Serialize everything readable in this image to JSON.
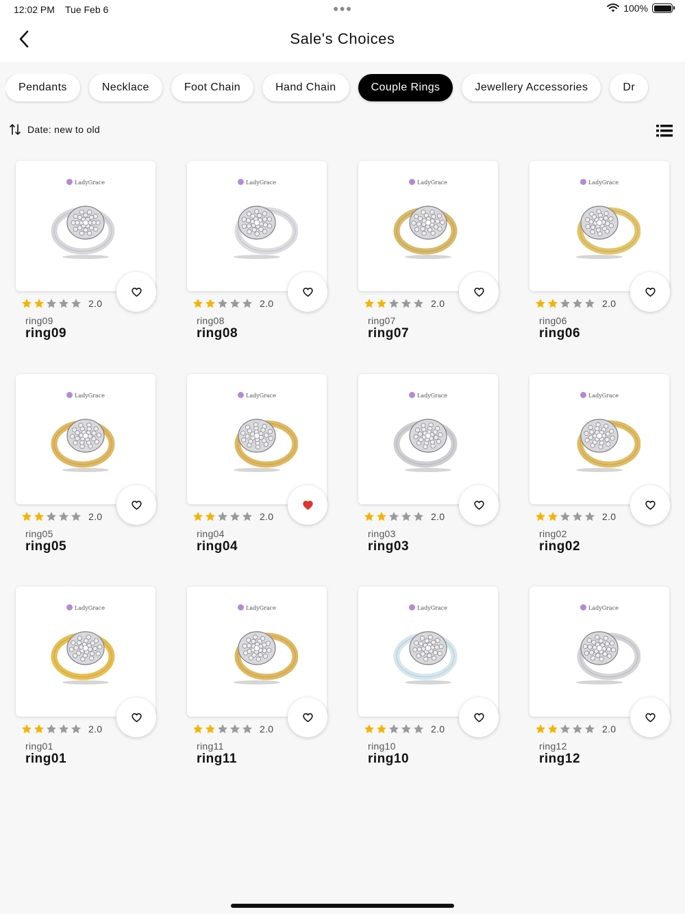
{
  "status": {
    "time": "12:02 PM",
    "date": "Tue Feb 6",
    "battery": "100%"
  },
  "nav": {
    "title": "Sale's Choices"
  },
  "categories": [
    {
      "label": "Pendants",
      "active": false
    },
    {
      "label": "Necklace",
      "active": false
    },
    {
      "label": "Foot Chain",
      "active": false
    },
    {
      "label": "Hand Chain",
      "active": false
    },
    {
      "label": "Couple Rings",
      "active": true
    },
    {
      "label": "Jewellery Accessories",
      "active": false
    },
    {
      "label": "Dr",
      "active": false
    }
  ],
  "sort": {
    "label": "Date: new to old"
  },
  "brand": "LadyGrace",
  "products": [
    {
      "sub": "ring09",
      "name": "ring09",
      "rating": "2.0",
      "stars": 2,
      "favorite": false,
      "metal": "#d8d8dc"
    },
    {
      "sub": "ring08",
      "name": "ring08",
      "rating": "2.0",
      "stars": 2,
      "favorite": false,
      "metal": "#dcdce0"
    },
    {
      "sub": "ring07",
      "name": "ring07",
      "rating": "2.0",
      "stars": 2,
      "favorite": false,
      "metal": "#d9b96a"
    },
    {
      "sub": "ring06",
      "name": "ring06",
      "rating": "2.0",
      "stars": 2,
      "favorite": false,
      "metal": "#e2c46a"
    },
    {
      "sub": "ring05",
      "name": "ring05",
      "rating": "2.0",
      "stars": 2,
      "favorite": false,
      "metal": "#e0b860"
    },
    {
      "sub": "ring04",
      "name": "ring04",
      "rating": "2.0",
      "stars": 2,
      "favorite": true,
      "metal": "#e0b860"
    },
    {
      "sub": "ring03",
      "name": "ring03",
      "rating": "2.0",
      "stars": 2,
      "favorite": false,
      "metal": "#cfcfd3"
    },
    {
      "sub": "ring02",
      "name": "ring02",
      "rating": "2.0",
      "stars": 2,
      "favorite": false,
      "metal": "#e0bc62"
    },
    {
      "sub": "ring01",
      "name": "ring01",
      "rating": "2.0",
      "stars": 2,
      "favorite": false,
      "metal": "#e8be50"
    },
    {
      "sub": "ring11",
      "name": "ring11",
      "rating": "2.0",
      "stars": 2,
      "favorite": false,
      "metal": "#e0b860"
    },
    {
      "sub": "ring10",
      "name": "ring10",
      "rating": "2.0",
      "stars": 2,
      "favorite": false,
      "metal": "#d6e6ef"
    },
    {
      "sub": "ring12",
      "name": "ring12",
      "rating": "2.0",
      "stars": 2,
      "favorite": false,
      "metal": "#d4d4d8"
    }
  ],
  "colors": {
    "star_on": "#f5b301",
    "star_off": "#9a9a9a",
    "heart_active": "#e0332f",
    "chip_active_bg": "#000000"
  },
  "icons": {
    "back": "chevron-left-icon",
    "sort": "sort-arrows-icon",
    "list": "list-view-icon",
    "heart": "heart-icon"
  }
}
